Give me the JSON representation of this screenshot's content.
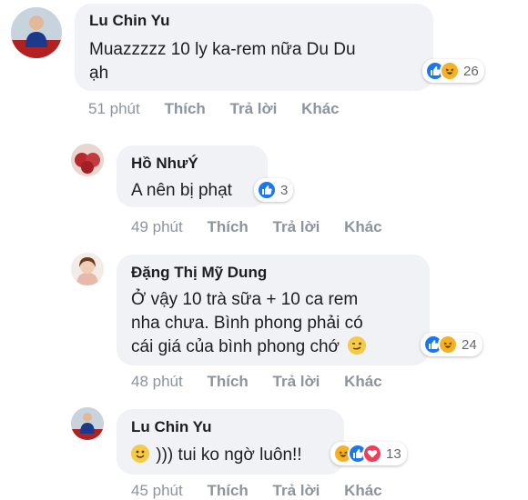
{
  "comments": [
    {
      "author": "Lu Chin Yu",
      "text_line1": "Muazzzzz 10 ly ka-rem nữa Du Du",
      "text_line2": "ạh",
      "reaction_count": "26",
      "time": "51 phút"
    },
    {
      "author": "Hồ NhưÝ",
      "text_line1": "A nên bị phạt",
      "reaction_count": "3",
      "time": "49 phút"
    },
    {
      "author": "Đặng Thị Mỹ Dung",
      "text_line1": "Ở vậy 10 trà sữa + 10 ca rem",
      "text_line2": "nha chưa. Bình phong phải có",
      "text_line3": "cái giá của bình phong chớ",
      "reaction_count": "24",
      "time": "48 phút"
    },
    {
      "author": "Lu Chin Yu",
      "text_line1": "))) tui ko ngờ luôn!!",
      "reaction_count": "13",
      "time": "45 phút"
    }
  ],
  "actions": {
    "like": "Thích",
    "reply": "Trả lời",
    "more": "Khác"
  },
  "colors": {
    "like": "#1877f2",
    "haha": "#f7b125",
    "love": "#f33e58",
    "bubble": "#f0f2f5",
    "meta": "#8d949e"
  },
  "icons": {
    "like": "thumbs-up-icon",
    "haha": "laughing-face-icon",
    "love": "heart-icon",
    "wink": "wink-emoji-icon",
    "smile": "smile-emoji-icon"
  }
}
